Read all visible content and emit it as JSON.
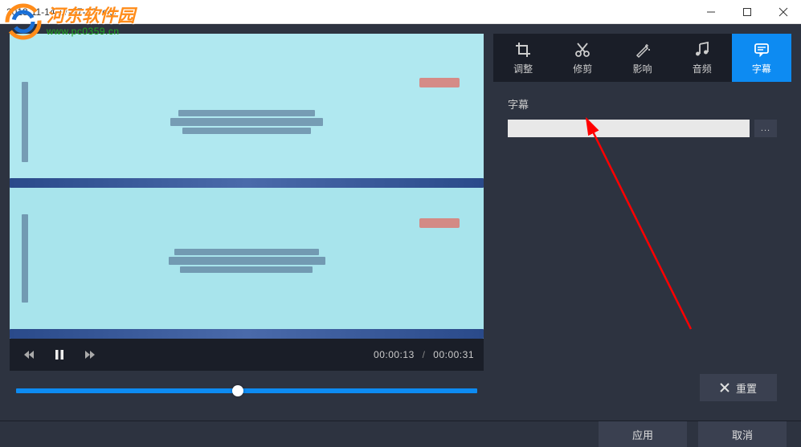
{
  "window": {
    "title": "2018-11-14 17-27-22.mkv"
  },
  "watermark": {
    "name": "河东软件园",
    "url": "www.pc0359.cn"
  },
  "player": {
    "current_time": "00:00:13",
    "total_time": "00:00:31",
    "separator": "/"
  },
  "tabs": {
    "adjust": "调整",
    "trim": "修剪",
    "effect": "影响",
    "audio": "音频",
    "subtitle": "字幕"
  },
  "subtitle_panel": {
    "label": "字幕",
    "input_value": "",
    "browse_label": "..."
  },
  "buttons": {
    "reset": "重置",
    "apply": "应用",
    "cancel": "取消"
  },
  "icons": {
    "crop": "crop-icon",
    "scissors": "scissors-icon",
    "sparkle": "sparkle-icon",
    "music": "music-icon",
    "chat": "chat-icon",
    "rewind": "rewind-icon",
    "pause": "pause-icon",
    "forward": "forward-icon",
    "close_x": "close-icon"
  }
}
